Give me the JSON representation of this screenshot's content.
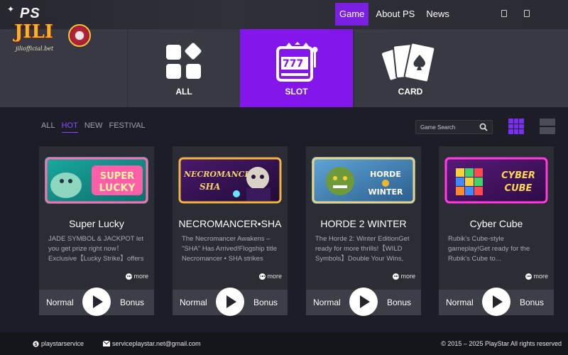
{
  "logo": {
    "ps": "PS",
    "jili": "JILI",
    "sub": "jiliofficial.bet"
  },
  "nav": [
    {
      "label": "Game",
      "active": true
    },
    {
      "label": "About PS",
      "active": false
    },
    {
      "label": "News",
      "active": false
    }
  ],
  "categories": [
    {
      "label": "ALL",
      "icon": "all-icon"
    },
    {
      "label": "SLOT",
      "icon": "slot-machine-icon",
      "active": true
    },
    {
      "label": "CARD",
      "icon": "playing-cards-icon"
    }
  ],
  "filters": [
    {
      "label": "ALL"
    },
    {
      "label": "HOT",
      "active": true
    },
    {
      "label": "NEW"
    },
    {
      "label": "FESTIVAL"
    }
  ],
  "search": {
    "placeholder": "Game Search"
  },
  "games": [
    {
      "thumb_text": "SUPER LUCKY",
      "title": "Super Lucky",
      "desc": "JADE SYMBOL & JACKPOT let you get prize right now！ Exclusive【Lucky Strike】offers prices of...",
      "more": "more",
      "normal": "Normal",
      "bonus": "Bonus"
    },
    {
      "thumb_text": "NECROMANCER SHA",
      "title": "NECROMANCER•SHA",
      "desc": "The Necromancer Awakens – \"SHA\" Has Arrived!Flogship title Necromancer • SHA strikes with...",
      "more": "more",
      "normal": "Normal",
      "bonus": "Bonus"
    },
    {
      "thumb_text": "HORDE 2 WINTER",
      "title": "HORDE 2 WINTER",
      "desc": "The Horde 2: Winter EditionGet ready for more thrills!【WILD Symbols】Double Your Wins, Up...",
      "more": "more",
      "normal": "Normal",
      "bonus": "Bonus"
    },
    {
      "thumb_text": "CYBER CUBE",
      "title": "Cyber Cube",
      "desc": "Rubik's Cube-style gameplay!Get ready for the Rubik's Cube to...",
      "more": "more",
      "normal": "Normal",
      "bonus": "Bonus"
    }
  ],
  "footer": {
    "skype": "playstarservice",
    "email": "serviceplaystar.net@gmail.com",
    "copyright": "© 2015 – 2025 PlayStar All rights reserved"
  },
  "colors": {
    "accent": "#8316ea",
    "card_bg": "#2b2d35",
    "band_bg": "#373943"
  }
}
